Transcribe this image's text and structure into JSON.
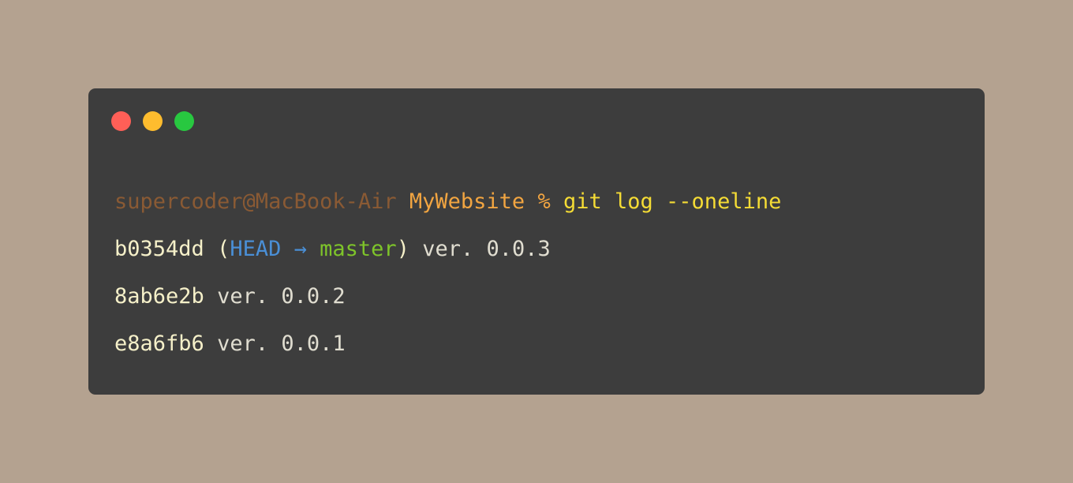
{
  "window": {
    "buttons": [
      {
        "name": "close",
        "color": "#ff5f57"
      },
      {
        "name": "minimize",
        "color": "#febc2e"
      },
      {
        "name": "zoom",
        "color": "#28c840"
      }
    ]
  },
  "colors": {
    "page_background": "#b4a290",
    "terminal_background": "#3d3d3d",
    "user_host": "#8a5a34",
    "directory": "#f2a541",
    "command": "#f5dc35",
    "hash": "#f5f0c9",
    "text": "#e0ddd0",
    "head": "#4a8fd6",
    "master": "#7ec42a"
  },
  "prompt": {
    "user_host": "supercoder@MacBook-Air",
    "directory": "MyWebsite",
    "symbol": "%",
    "command": "git log --oneline"
  },
  "log": [
    {
      "hash": "b0354dd",
      "open_paren": "(",
      "head": "HEAD",
      "arrow": "→",
      "branch": "master",
      "close_paren": ")",
      "message": "ver. 0.0.3"
    },
    {
      "hash": "8ab6e2b",
      "message": "ver. 0.0.2"
    },
    {
      "hash": "e8a6fb6",
      "message": "ver. 0.0.1"
    }
  ]
}
